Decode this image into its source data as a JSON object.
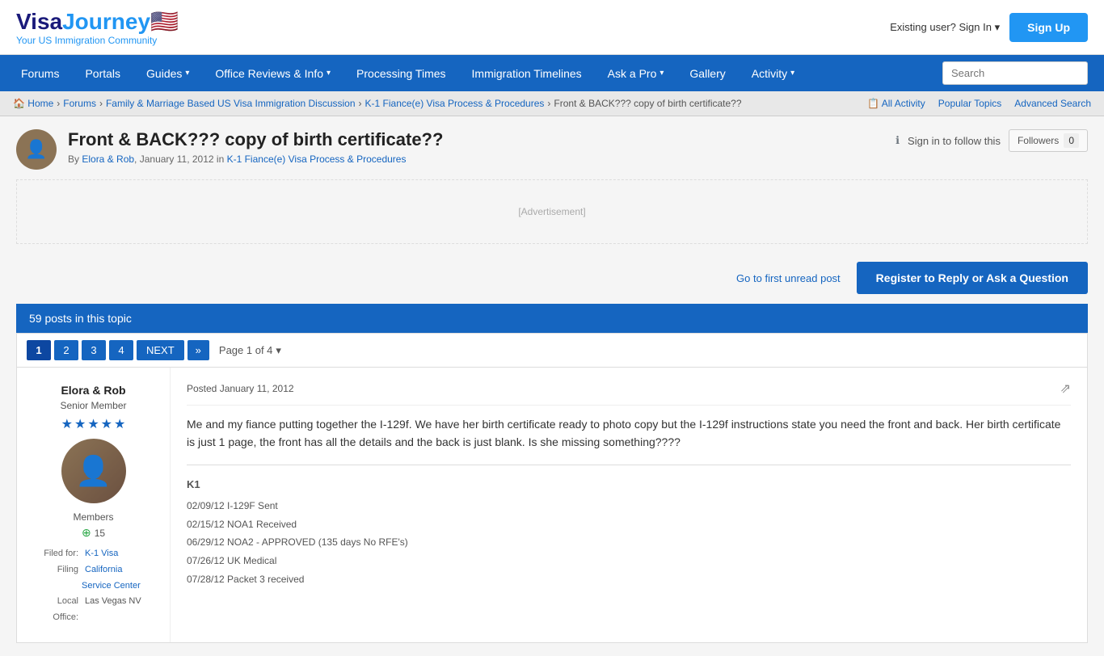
{
  "site": {
    "logo_visa": "Visa",
    "logo_journey": "Journey",
    "logo_flag": "🇺🇸",
    "logo_tagline": "Your US Immigration Community"
  },
  "header": {
    "existing_user_label": "Existing user? Sign In",
    "existing_user_caret": "▾",
    "signup_label": "Sign Up"
  },
  "nav": {
    "items": [
      {
        "label": "Forums",
        "has_caret": false
      },
      {
        "label": "Portals",
        "has_caret": false
      },
      {
        "label": "Guides",
        "has_caret": true
      },
      {
        "label": "Office Reviews & Info",
        "has_caret": true
      },
      {
        "label": "Processing Times",
        "has_caret": false
      },
      {
        "label": "Immigration Timelines",
        "has_caret": false
      },
      {
        "label": "Ask a Pro",
        "has_caret": true
      },
      {
        "label": "Gallery",
        "has_caret": false
      },
      {
        "label": "Activity",
        "has_caret": true
      }
    ],
    "search_placeholder": "Search"
  },
  "breadcrumb": {
    "items": [
      {
        "label": "🏠 Home",
        "href": "#"
      },
      {
        "label": "Forums",
        "href": "#"
      },
      {
        "label": "Family & Marriage Based US Visa Immigration Discussion",
        "href": "#"
      },
      {
        "label": "K-1 Fiance(e) Visa Process & Procedures",
        "href": "#"
      },
      {
        "label": "Front & BACK??? copy of birth certificate??"
      }
    ],
    "actions": [
      {
        "label": "All Activity",
        "icon": "📋"
      },
      {
        "label": "Popular Topics"
      },
      {
        "label": "Advanced Search"
      }
    ]
  },
  "topic": {
    "title": "Front & BACK??? copy of birth certificate??",
    "author": "Elora & Rob",
    "date": "January 11, 2012",
    "category": "K-1 Fiance(e) Visa Process & Procedures",
    "follow_label": "Sign in to follow this",
    "followers_label": "Followers",
    "followers_count": "0"
  },
  "actions": {
    "first_unread": "Go to first unread post",
    "register_reply": "Register to Reply or Ask a Question"
  },
  "posts_bar": {
    "count_text": "59 posts in this topic"
  },
  "pagination": {
    "pages": [
      "1",
      "2",
      "3",
      "4"
    ],
    "current": "1",
    "next_label": "NEXT",
    "dbl_next_label": "»",
    "page_of": "Page 1 of 4",
    "caret": "▾"
  },
  "post": {
    "author": {
      "name": "Elora & Rob",
      "rank": "Senior Member",
      "stars": [
        "★",
        "★",
        "★",
        "★",
        "★"
      ],
      "type": "Members",
      "rep_icon": "⊕",
      "rep": "15",
      "filed_for_label": "Filed for:",
      "filed_for": "K-1 Visa",
      "filing_label": "Filing",
      "filing": "California",
      "service_label": "Service Center",
      "local_label": "Local",
      "local": "Las Vegas NV",
      "office_label": "Office:"
    },
    "date": "Posted January 11, 2012",
    "text": "Me and my fiance putting together the I-129f. We have her birth certificate ready to photo copy but the I-129f instructions state you need the front and back. Her birth certificate is just 1 page, the front has all the details and the back is just blank. Is she missing something????",
    "signature": {
      "title": "K1",
      "rows": [
        "02/09/12 I-129F Sent",
        "02/15/12 NOA1 Received",
        "06/29/12 NOA2 - APPROVED (135 days No RFE's)",
        "07/26/12 UK Medical",
        "07/28/12 Packet 3 received"
      ]
    }
  }
}
